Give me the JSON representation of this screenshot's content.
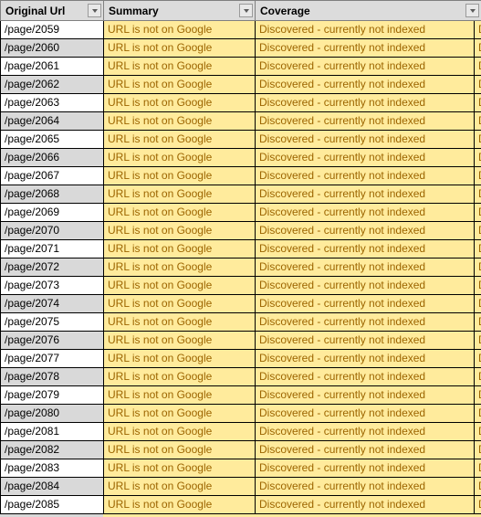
{
  "app": {
    "type": "spreadsheet-table",
    "view": "filtered-data-range"
  },
  "colors": {
    "header_bg": "#DCDCDC",
    "band_bg": "#D9D9D9",
    "neutral_bg": "#FFEB9C",
    "neutral_text": "#9C6500",
    "gridline": "#000000",
    "text": "#000000"
  },
  "table": {
    "columns": [
      {
        "key": "original_url",
        "label": "Original Url",
        "filter_icon": "chevron-down-icon",
        "filter_enabled": true
      },
      {
        "key": "summary",
        "label": "Summary",
        "filter_icon": "chevron-down-icon",
        "filter_enabled": true
      },
      {
        "key": "coverage",
        "label": "Coverage",
        "filter_icon": "chevron-down-icon",
        "filter_enabled": true
      }
    ],
    "clipped_column_text": "D",
    "rows": [
      {
        "original_url": "/page/2059",
        "summary": "URL is not on Google",
        "coverage": "Discovered - currently not indexed"
      },
      {
        "original_url": "/page/2060",
        "summary": "URL is not on Google",
        "coverage": "Discovered - currently not indexed"
      },
      {
        "original_url": "/page/2061",
        "summary": "URL is not on Google",
        "coverage": "Discovered - currently not indexed"
      },
      {
        "original_url": "/page/2062",
        "summary": "URL is not on Google",
        "coverage": "Discovered - currently not indexed"
      },
      {
        "original_url": "/page/2063",
        "summary": "URL is not on Google",
        "coverage": "Discovered - currently not indexed"
      },
      {
        "original_url": "/page/2064",
        "summary": "URL is not on Google",
        "coverage": "Discovered - currently not indexed"
      },
      {
        "original_url": "/page/2065",
        "summary": "URL is not on Google",
        "coverage": "Discovered - currently not indexed"
      },
      {
        "original_url": "/page/2066",
        "summary": "URL is not on Google",
        "coverage": "Discovered - currently not indexed"
      },
      {
        "original_url": "/page/2067",
        "summary": "URL is not on Google",
        "coverage": "Discovered - currently not indexed"
      },
      {
        "original_url": "/page/2068",
        "summary": "URL is not on Google",
        "coverage": "Discovered - currently not indexed"
      },
      {
        "original_url": "/page/2069",
        "summary": "URL is not on Google",
        "coverage": "Discovered - currently not indexed"
      },
      {
        "original_url": "/page/2070",
        "summary": "URL is not on Google",
        "coverage": "Discovered - currently not indexed"
      },
      {
        "original_url": "/page/2071",
        "summary": "URL is not on Google",
        "coverage": "Discovered - currently not indexed"
      },
      {
        "original_url": "/page/2072",
        "summary": "URL is not on Google",
        "coverage": "Discovered - currently not indexed"
      },
      {
        "original_url": "/page/2073",
        "summary": "URL is not on Google",
        "coverage": "Discovered - currently not indexed"
      },
      {
        "original_url": "/page/2074",
        "summary": "URL is not on Google",
        "coverage": "Discovered - currently not indexed"
      },
      {
        "original_url": "/page/2075",
        "summary": "URL is not on Google",
        "coverage": "Discovered - currently not indexed"
      },
      {
        "original_url": "/page/2076",
        "summary": "URL is not on Google",
        "coverage": "Discovered - currently not indexed"
      },
      {
        "original_url": "/page/2077",
        "summary": "URL is not on Google",
        "coverage": "Discovered - currently not indexed"
      },
      {
        "original_url": "/page/2078",
        "summary": "URL is not on Google",
        "coverage": "Discovered - currently not indexed"
      },
      {
        "original_url": "/page/2079",
        "summary": "URL is not on Google",
        "coverage": "Discovered - currently not indexed"
      },
      {
        "original_url": "/page/2080",
        "summary": "URL is not on Google",
        "coverage": "Discovered - currently not indexed"
      },
      {
        "original_url": "/page/2081",
        "summary": "URL is not on Google",
        "coverage": "Discovered - currently not indexed"
      },
      {
        "original_url": "/page/2082",
        "summary": "URL is not on Google",
        "coverage": "Discovered - currently not indexed"
      },
      {
        "original_url": "/page/2083",
        "summary": "URL is not on Google",
        "coverage": "Discovered - currently not indexed"
      },
      {
        "original_url": "/page/2084",
        "summary": "URL is not on Google",
        "coverage": "Discovered - currently not indexed"
      },
      {
        "original_url": "/page/2085",
        "summary": "URL is not on Google",
        "coverage": "Discovered - currently not indexed"
      }
    ]
  }
}
